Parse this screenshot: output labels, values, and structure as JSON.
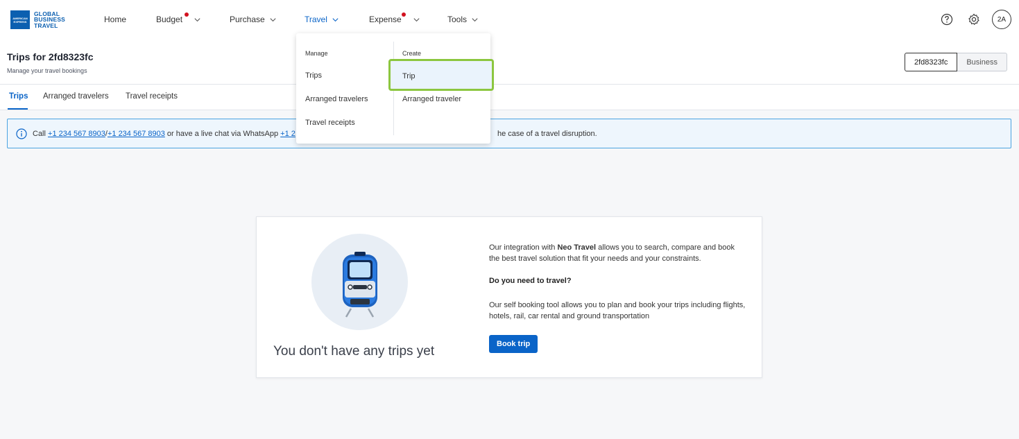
{
  "logo": {
    "box_lines": [
      "AMERICAN",
      "EXPRESS"
    ],
    "text_lines": [
      "GLOBAL",
      "BUSINESS",
      "TRAVEL"
    ]
  },
  "nav": {
    "home": "Home",
    "budget": "Budget",
    "purchase": "Purchase",
    "travel": "Travel",
    "expense": "Expense",
    "tools": "Tools"
  },
  "header_icons": {
    "help": "help-icon",
    "settings": "gear-icon",
    "avatar": "2A"
  },
  "page": {
    "title": "Trips for 2fd8323fc",
    "subtitle": "Manage your travel bookings",
    "segment_selected": "2fd8323fc",
    "segment_other": "Business"
  },
  "tabs": [
    "Trips",
    "Arranged travelers",
    "Travel receipts"
  ],
  "banner": {
    "prefix": "Call ",
    "phone1": "+1 234 567 8903",
    "sep": "/",
    "phone2": "+1 234 567 8903",
    "middle": " or have a live chat via WhatsApp ",
    "phone3": "+1 2",
    "tail": "he case of a travel disruption."
  },
  "dropdown": {
    "manage_header": "Manage",
    "manage_items": [
      "Trips",
      "Arranged travelers",
      "Travel receipts"
    ],
    "create_header": "Create",
    "create_items": [
      "Trip",
      "Arranged traveler"
    ]
  },
  "empty_state": {
    "title": "You don't have any trips yet",
    "p1_before": "Our integration with ",
    "p1_bold": "Neo Travel",
    "p1_after": " allows you to search, compare and book the best travel solution that fit your needs and your constraints.",
    "question": "Do you need to travel?",
    "p2": "Our self booking tool allows you to plan and book your trips including flights, hotels, rail, car rental and ground transportation",
    "button": "Book trip"
  },
  "colors": {
    "accent": "#0a64c8",
    "alert_dot": "#d2121f",
    "highlight_border": "#8cc63f",
    "banner_border": "#4aa3e0"
  }
}
